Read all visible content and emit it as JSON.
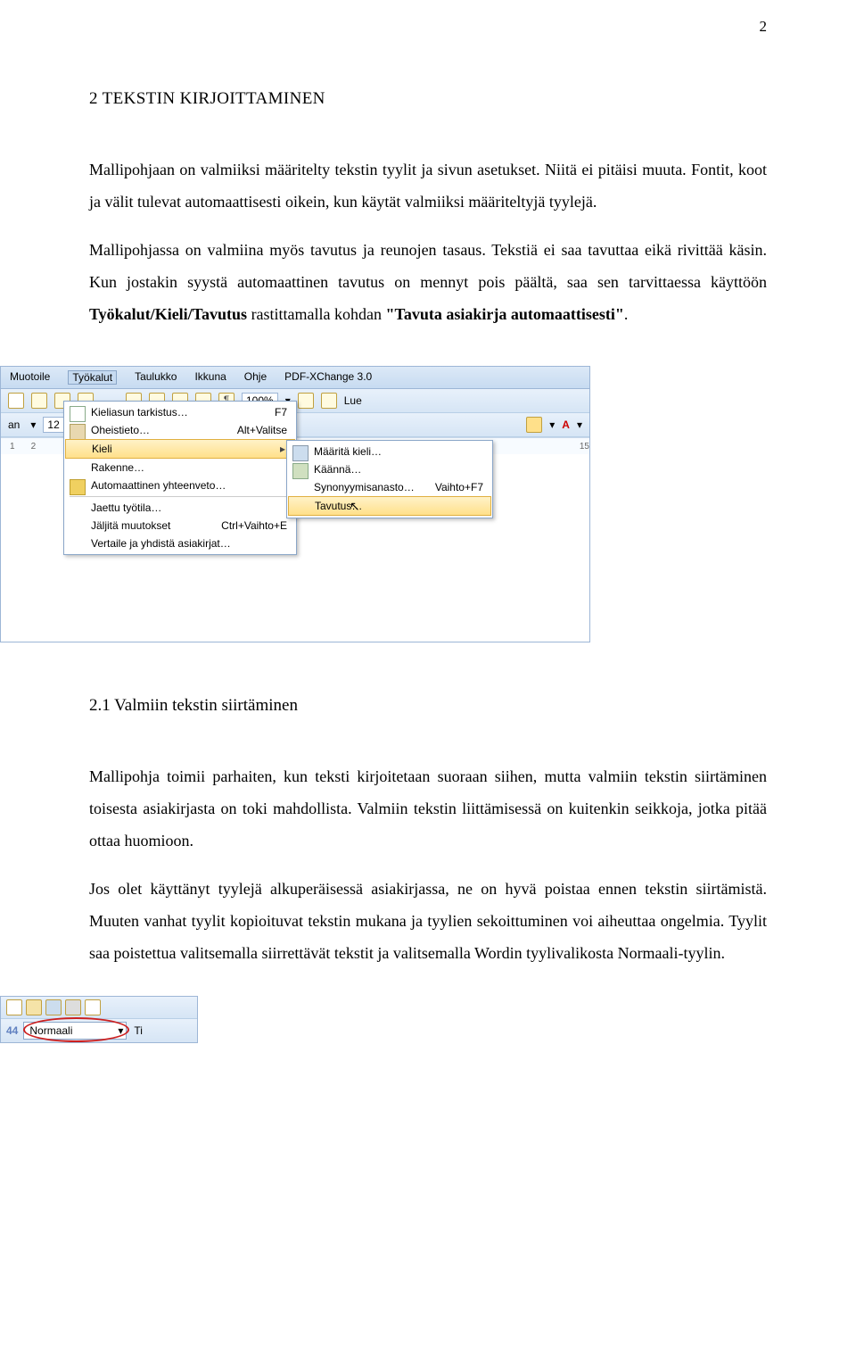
{
  "page": {
    "number": "2",
    "h1": "2  TEKSTIN KIRJOITTAMINEN",
    "p1": "Mallipohjaan on valmiiksi määritelty tekstin tyylit ja sivun asetukset. Niitä ei pitäisi muuta. Fontit, koot ja välit tulevat automaattisesti oikein, kun käytät valmiiksi määriteltyjä tyylejä.",
    "p2a": "Mallipohjassa on valmiina myös tavutus ja reunojen tasaus. Tekstiä ei saa tavuttaa eikä rivittää käsin. Kun jostakin syystä automaattinen tavutus on mennyt pois päältä, saa sen tarvittaessa käyttöön ",
    "p2b": "Työkalut/Kieli/Tavutus",
    "p2c": " rastittamalla kohdan ",
    "p2d": "\"Tavuta asiakirja automaattisesti\"",
    "p2e": ".",
    "h2": "2.1  Valmiin tekstin siirtäminen",
    "p3": "Mallipohja toimii parhaiten, kun teksti kirjoitetaan suoraan siihen, mutta valmiin tekstin siirtäminen toisesta asiakirjasta on toki mahdollista. Valmiin tekstin liittämisessä on kuitenkin seikkoja, jotka pitää ottaa huomioon.",
    "p4": "Jos olet käyttänyt tyylejä alkuperäisessä asiakirjassa, ne on hyvä poistaa ennen tekstin siirtämistä. Muuten vanhat tyylit kopioituvat tekstin mukana ja tyylien sekoittuminen voi aiheuttaa ongelmia. Tyylit saa poistettua valitsemalla siirrettävät tekstit ja valitsemalla Wordin tyylivalikosta Normaali-tyylin."
  },
  "menubar": {
    "muotoile": "Muotoile",
    "tyokalut": "Työkalut",
    "taulukko": "Taulukko",
    "ikkuna": "Ikkuna",
    "ohje": "Ohje",
    "pdf": "PDF-XChange 3.0"
  },
  "toolbar": {
    "fontsize": "12",
    "zoom": "100%",
    "lue": "Lue"
  },
  "ruler": {
    "r1": "1",
    "r2": "2",
    "r15": "15"
  },
  "dropdown": {
    "kieliasu": "Kieliasun tarkistus…",
    "kieliasu_sc": "F7",
    "oheistieto": "Oheistieto…",
    "oheistieto_sc": "Alt+Valitse",
    "kieli": "Kieli",
    "rakenne": "Rakenne…",
    "autoyv": "Automaattinen yhteenveto…",
    "jaettu": "Jaettu työtila…",
    "jaljita": "Jäljitä muutokset",
    "jaljita_sc": "Ctrl+Vaihto+E",
    "vertaile": "Vertaile ja yhdistä asiakirjat…"
  },
  "submenu": {
    "maarita": "Määritä kieli…",
    "kaanna": "Käännä…",
    "syno": "Synonyymisanasto…",
    "syno_sc": "Vaihto+F7",
    "tavutus": "Tavutus…"
  },
  "styleshot": {
    "fontnum": "44",
    "style": "Normaali",
    "ti": "Ti"
  }
}
